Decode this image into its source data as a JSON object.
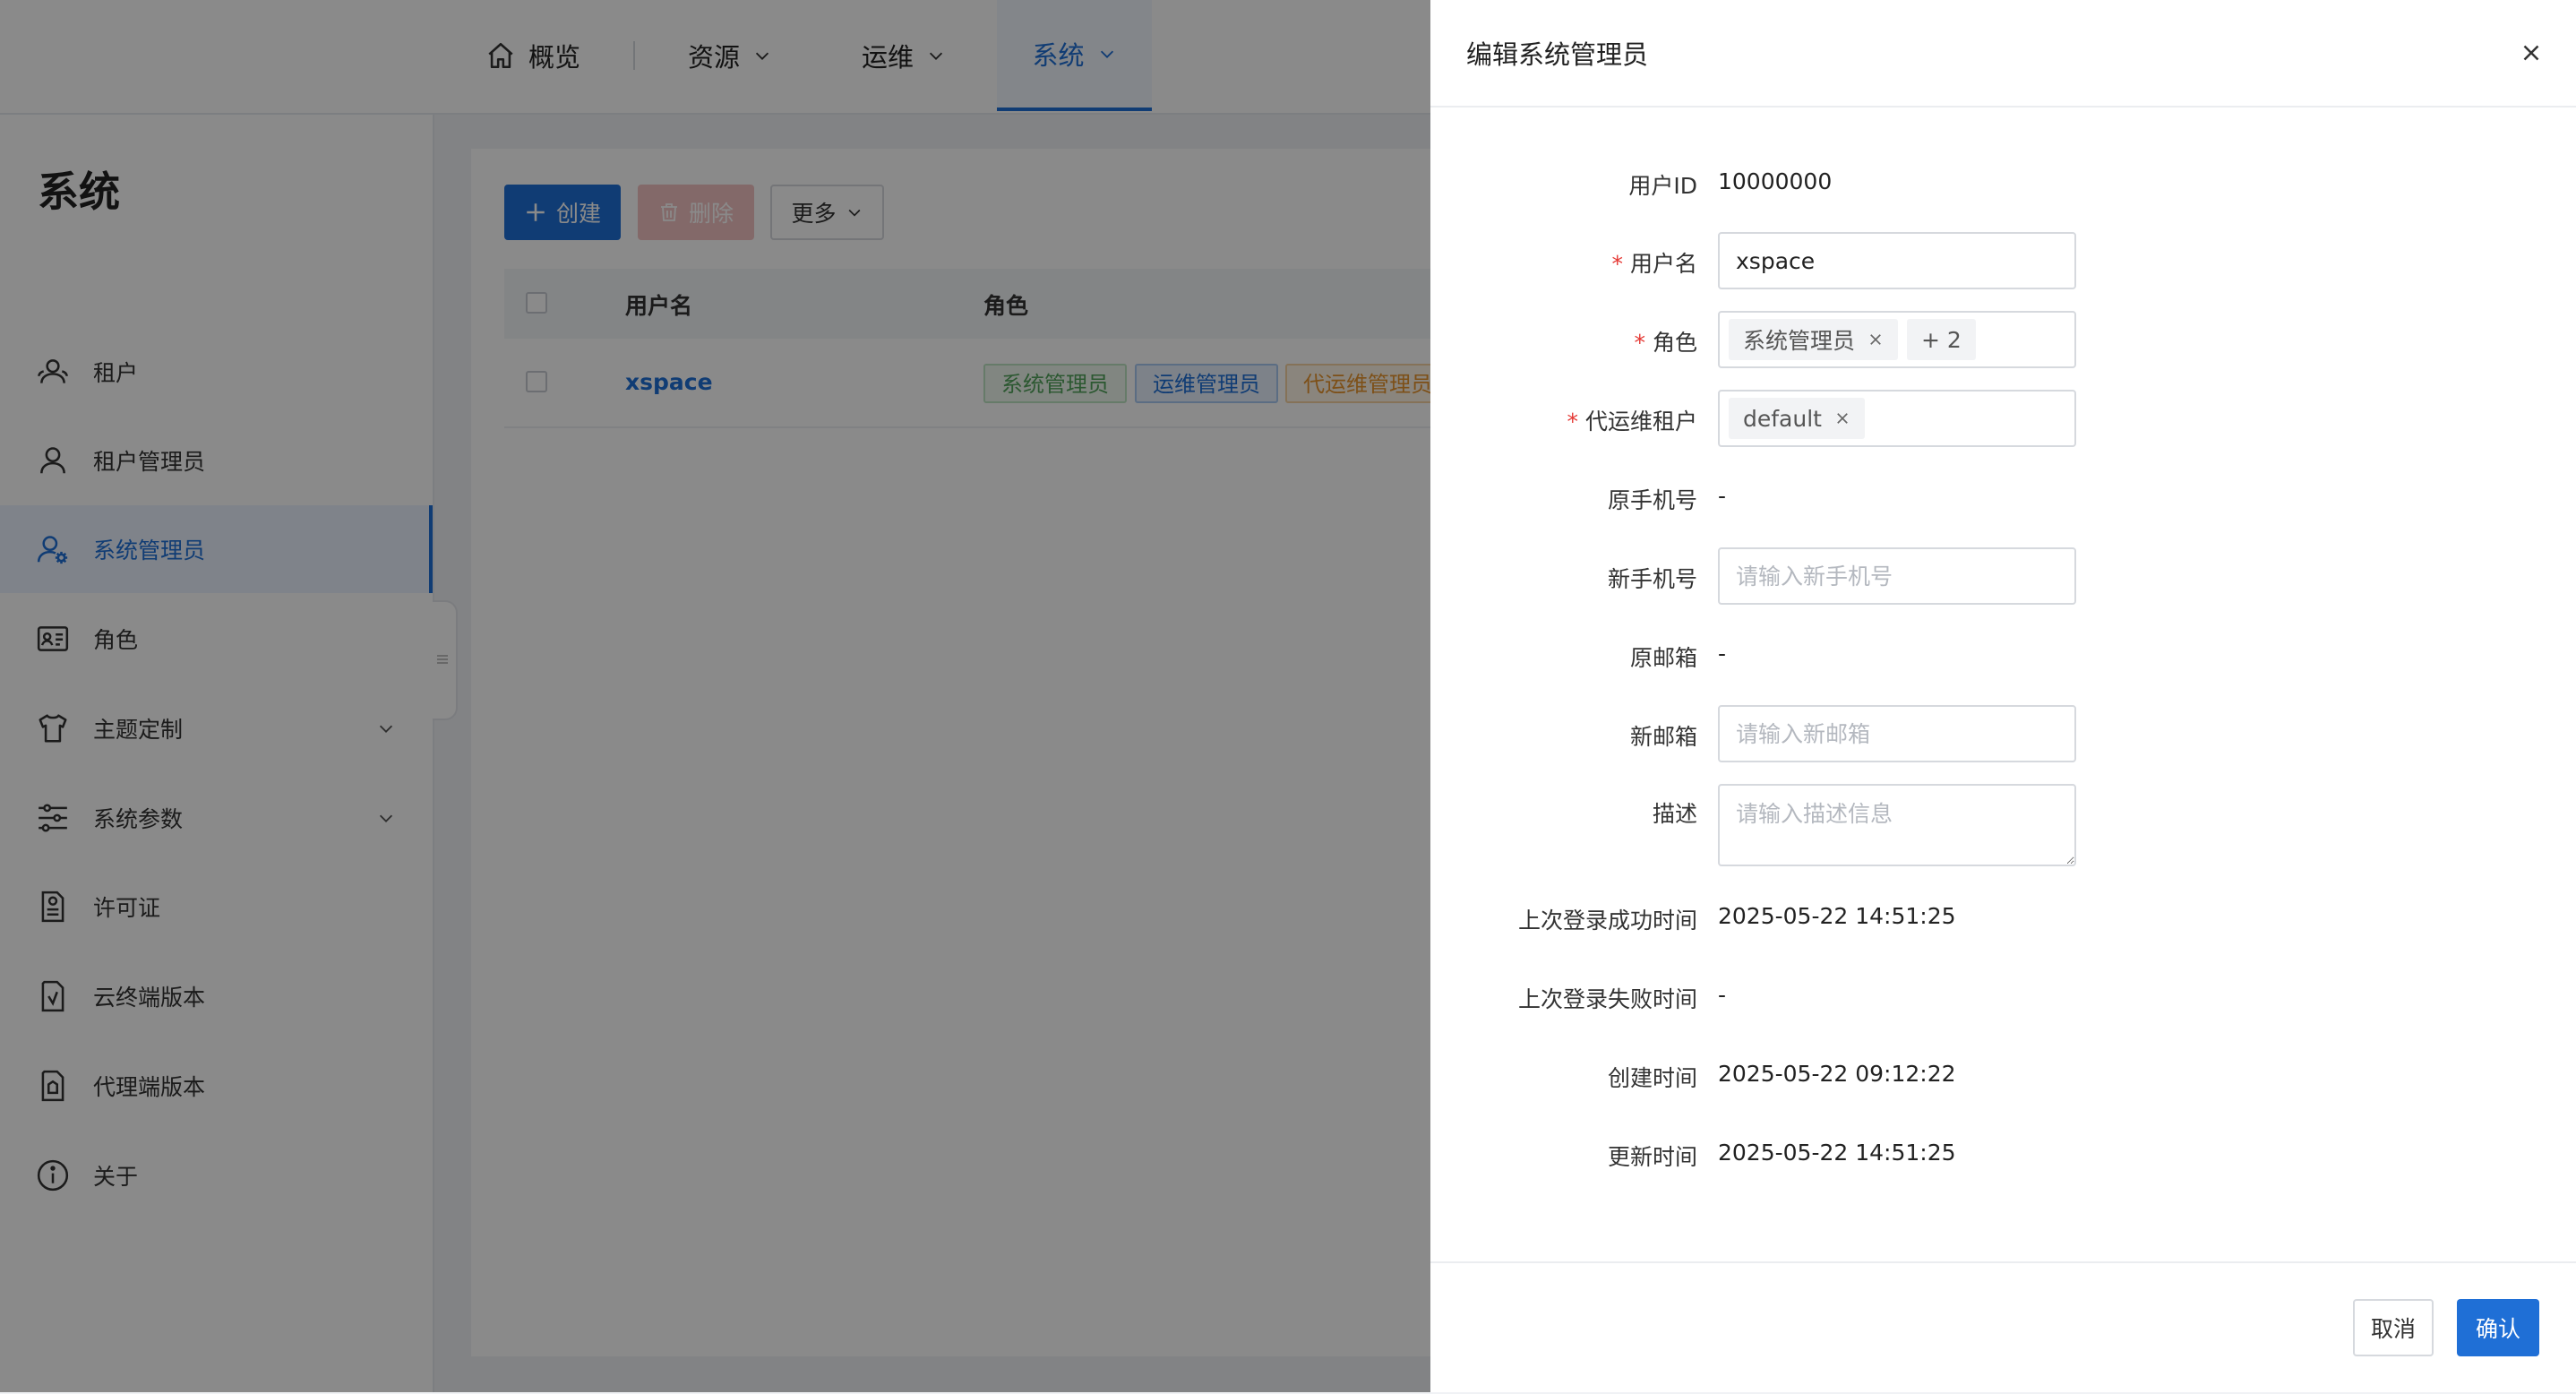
{
  "nav": {
    "items": [
      {
        "label": "概览",
        "icon": "home-icon"
      },
      {
        "label": "资源"
      },
      {
        "label": "运维"
      },
      {
        "label": "系统"
      }
    ],
    "accent": "#1f6fd6"
  },
  "sidebar": {
    "title": "系统",
    "items": [
      {
        "label": "租户",
        "icon": "users-icon"
      },
      {
        "label": "租户管理员",
        "icon": "user-icon"
      },
      {
        "label": "系统管理员",
        "icon": "user-gear-icon"
      },
      {
        "label": "角色",
        "icon": "id-card-icon"
      },
      {
        "label": "主题定制",
        "icon": "shirt-icon"
      },
      {
        "label": "系统参数",
        "icon": "sliders-icon"
      },
      {
        "label": "许可证",
        "icon": "license-icon"
      },
      {
        "label": "云终端版本",
        "icon": "cloud-terminal-icon"
      },
      {
        "label": "代理端版本",
        "icon": "proxy-icon"
      },
      {
        "label": "关于",
        "icon": "info-icon"
      }
    ]
  },
  "toolbar": {
    "create_label": "创建",
    "delete_label": "删除",
    "more_label": "更多"
  },
  "table": {
    "columns": [
      "用户名",
      "角色"
    ],
    "rows": [
      {
        "username": "xspace",
        "roles": [
          "系统管理员",
          "运维管理员",
          "代运维管理员"
        ]
      }
    ]
  },
  "drawer": {
    "title": "编辑系统管理员",
    "fields": {
      "user_id": {
        "label": "用户ID",
        "value": "10000000"
      },
      "username": {
        "label": "用户名",
        "value": "xspace"
      },
      "role": {
        "label": "角色",
        "chip": "系统管理员",
        "more": "+ 2"
      },
      "tenant": {
        "label": "代运维租户",
        "chip": "default"
      },
      "old_phone": {
        "label": "原手机号",
        "value": "-"
      },
      "new_phone": {
        "label": "新手机号",
        "placeholder": "请输入新手机号"
      },
      "old_email": {
        "label": "原邮箱",
        "value": "-"
      },
      "new_email": {
        "label": "新邮箱",
        "placeholder": "请输入新邮箱"
      },
      "description": {
        "label": "描述",
        "placeholder": "请输入描述信息"
      },
      "last_login_success": {
        "label": "上次登录成功时间",
        "value": "2025-05-22 14:51:25"
      },
      "last_login_fail": {
        "label": "上次登录失败时间",
        "value": "-"
      },
      "created": {
        "label": "创建时间",
        "value": "2025-05-22 09:12:22"
      },
      "updated": {
        "label": "更新时间",
        "value": "2025-05-22 14:51:25"
      }
    },
    "cancel_label": "取消",
    "confirm_label": "确认"
  },
  "colors": {
    "tag_green": "#52a35c",
    "tag_blue": "#1f6fd6",
    "tag_orange": "#e8952e",
    "required": "#e53935"
  }
}
